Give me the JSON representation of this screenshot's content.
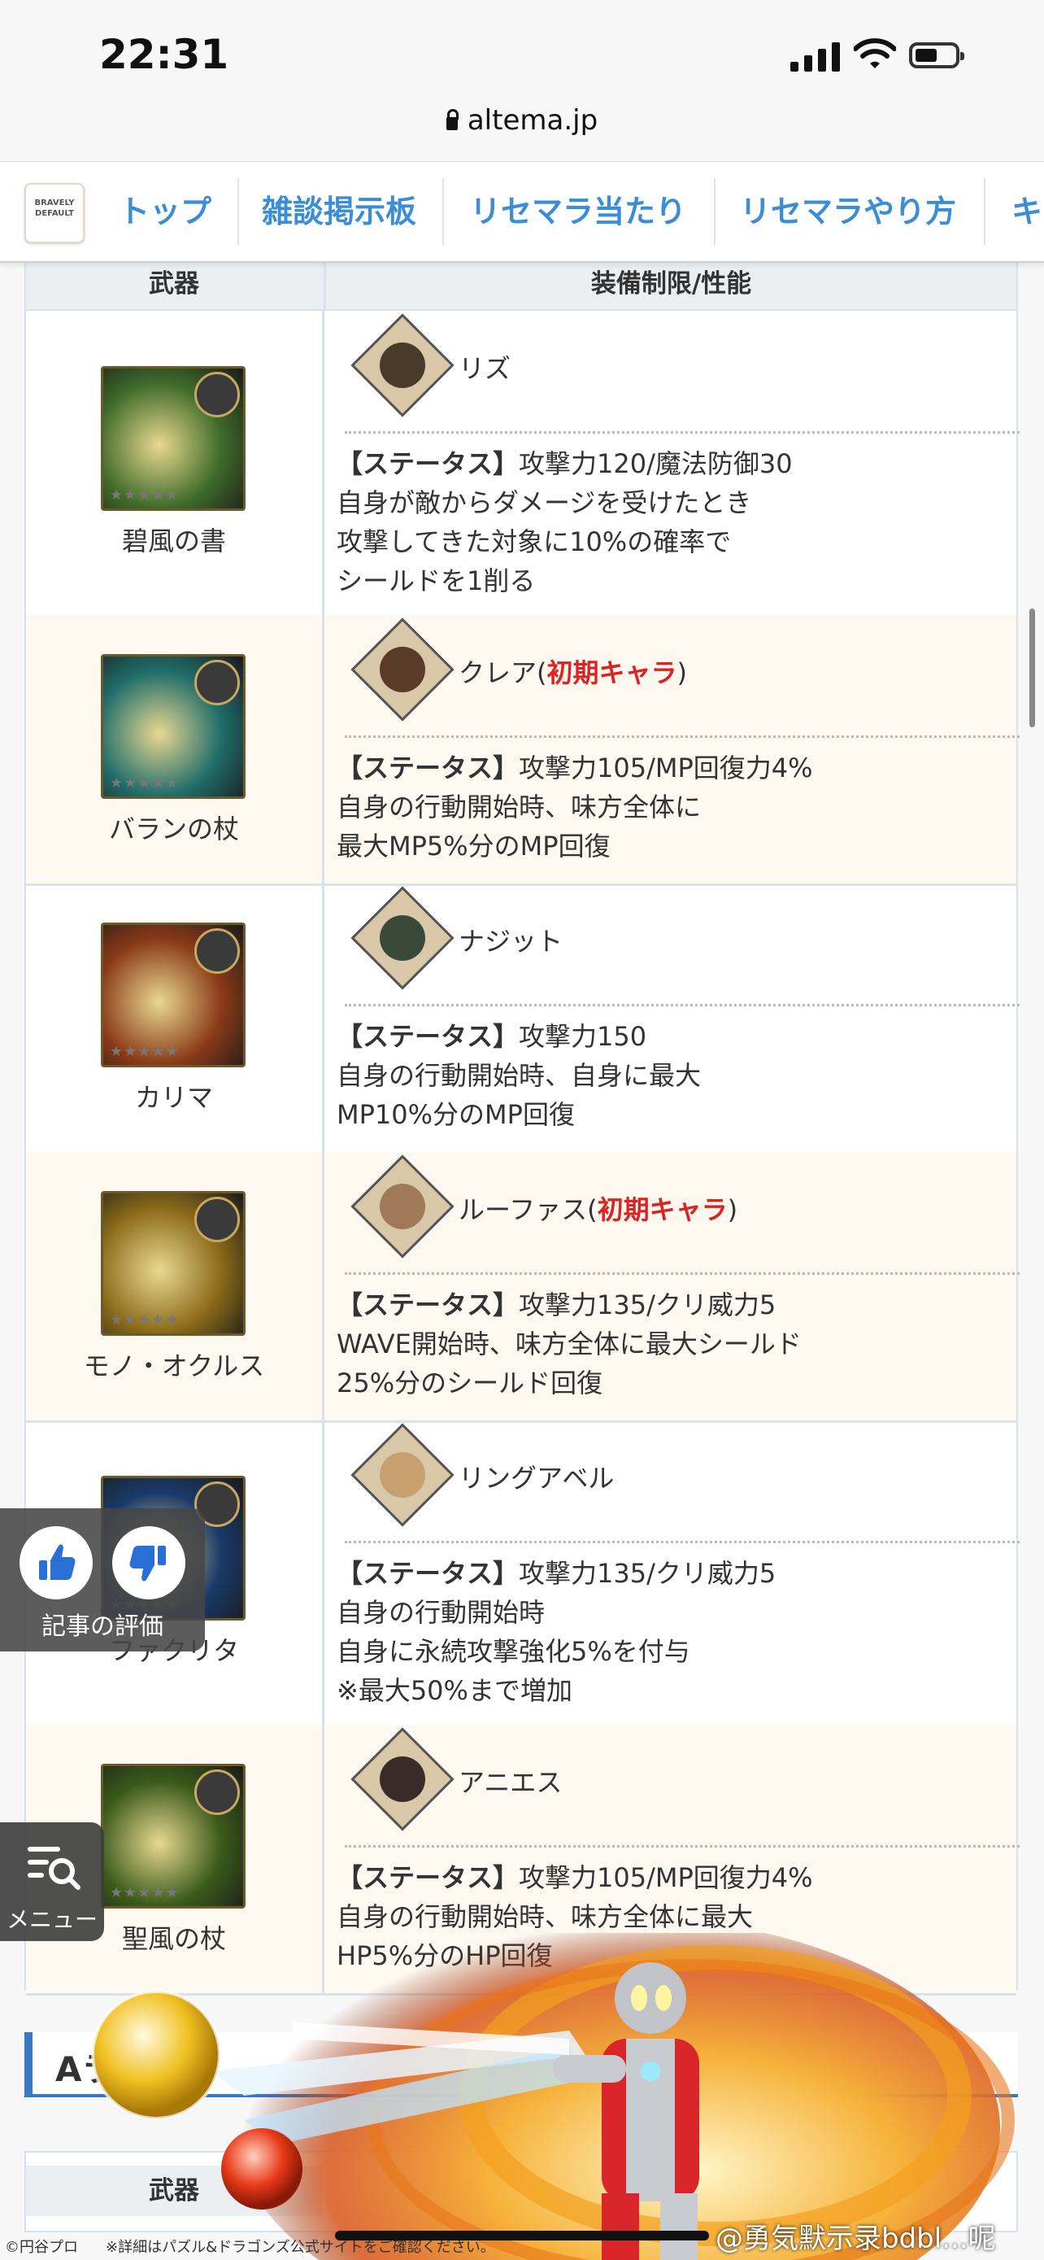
{
  "status_bar": {
    "time": "22:31"
  },
  "browser": {
    "url": "altema.jp"
  },
  "nav": {
    "logo_text": "BRAVELY DEFAULT",
    "tabs": [
      "トップ",
      "雑談掲示板",
      "リセマラ当たり",
      "リセマラやり方",
      "キ"
    ]
  },
  "table": {
    "headers": [
      "武器",
      "装備制限/性能"
    ],
    "status_prefix": "【ステータス】",
    "initial_char": "初期キャラ",
    "rows": [
      {
        "weapon": "碧風の書",
        "character": "リズ",
        "initial": false,
        "status": "攻撃力120/魔法防御30",
        "effect": "自身が敵からダメージを受けたとき\n攻撃してきた対象に10%の確率で\nシールドを1削る",
        "icon_color": "#3f6b2a",
        "face_color": "#4a3a2a"
      },
      {
        "weapon": "バランの杖",
        "character": "クレア(",
        "initial": true,
        "close": ")",
        "status": "攻撃力105/MP回復力4%",
        "effect": "自身の行動開始時、味方全体に\n最大MP5%分のMP回復",
        "icon_color": "#1f6d6a",
        "face_color": "#5a3a28"
      },
      {
        "weapon": "カリマ",
        "character": "ナジット",
        "initial": false,
        "status": "攻撃力150",
        "effect": "自身の行動開始時、自身に最大\nMP10%分のMP回復",
        "icon_color": "#8a3a18",
        "face_color": "#3a4a3a"
      },
      {
        "weapon": "モノ・オクルス",
        "character": "ルーファス(",
        "initial": true,
        "close": ")",
        "status": "攻撃力135/クリ威力5",
        "effect": "WAVE開始時、味方全体に最大シールド\n25%分のシールド回復",
        "icon_color": "#8a6a18",
        "face_color": "#a07a58"
      },
      {
        "weapon": "ファクリタ",
        "character": "リングアベル",
        "initial": false,
        "status": "攻撃力135/クリ威力5",
        "effect": "自身の行動開始時\n自身に永続攻撃強化5%を付与\n※最大50%まで増加",
        "icon_color": "#1a3a6a",
        "face_color": "#c8a070"
      },
      {
        "weapon": "聖風の杖",
        "character": "アニエス",
        "initial": false,
        "status": "攻撃力105/MP回復力4%",
        "effect": "自身の行動開始時、味方全体に最大\nHP5%分のHP回復",
        "icon_color": "#3a5a1a",
        "face_color": "#3a2a2a"
      }
    ]
  },
  "rating": {
    "label": "記事の評価"
  },
  "menu": {
    "label": "メニュー"
  },
  "section": {
    "title": "Aラ"
  },
  "table2": {
    "header": "武器"
  },
  "footer": {
    "copyright": "©円谷プロ",
    "note": "※詳細はパズル&ドラゴンズ公式サイトをご確認ください。",
    "watermark": "@勇気默示录bdbl...呢"
  },
  "colors": {
    "link": "#3a8dd6",
    "accent_red": "#dd2222",
    "section_blue": "#3a78c4"
  }
}
